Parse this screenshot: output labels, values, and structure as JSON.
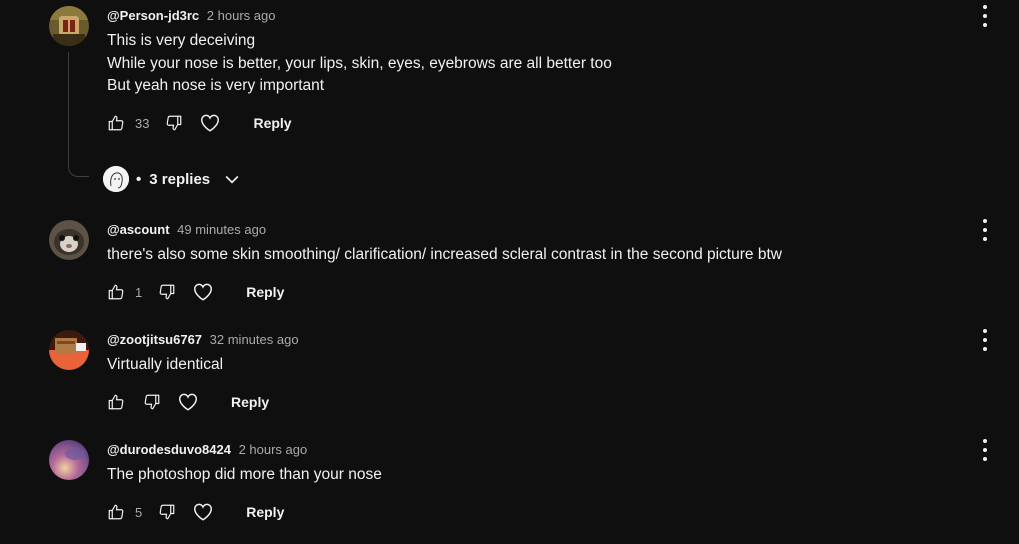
{
  "comments": [
    {
      "author": "@Person-jd3rc",
      "time": "2 hours ago",
      "lines": [
        "This is very deceiving",
        "While your nose is better, your lips, skin, eyes, eyebrows are all better too",
        "But yeah nose is very important"
      ],
      "likes": "33",
      "reply_label": "Reply"
    },
    {
      "author": "@ascount",
      "time": "49 minutes ago",
      "lines": [
        "there's also some skin smoothing/ clarification/ increased scleral contrast in the second picture btw"
      ],
      "likes": "1",
      "reply_label": "Reply"
    },
    {
      "author": "@zootjitsu6767",
      "time": "32 minutes ago",
      "lines": [
        "Virtually identical"
      ],
      "likes": "",
      "reply_label": "Reply"
    },
    {
      "author": "@durodesduvo8424",
      "time": "2 hours ago",
      "lines": [
        "The photoshop did more than your nose"
      ],
      "likes": "5",
      "reply_label": "Reply"
    }
  ],
  "replies_toggle": {
    "separator": "•",
    "label": "3 replies"
  },
  "icons": {
    "like": "thumbs-up-icon",
    "dislike": "thumbs-down-icon",
    "heart": "heart-icon",
    "menu": "more-vert-icon",
    "expand": "chevron-down-icon"
  },
  "colors": {
    "background": "#0f0f0f",
    "text_primary": "#f1f1f1",
    "text_secondary": "#aaaaaa"
  }
}
